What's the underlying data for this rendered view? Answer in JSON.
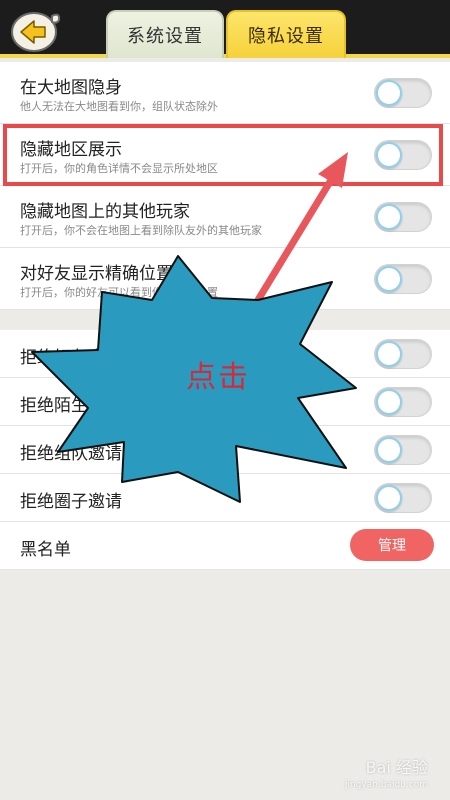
{
  "header": {
    "tabs": [
      {
        "label": "系统设置",
        "active": false
      },
      {
        "label": "隐私设置",
        "active": true
      }
    ]
  },
  "sections": [
    {
      "rows": [
        {
          "title": "在大地图隐身",
          "subtitle": "他人无法在大地图看到你，组队状态除外",
          "toggle_on": false
        },
        {
          "title": "隐藏地区展示",
          "subtitle": "打开后，你的角色详情不会显示所处地区",
          "toggle_on": false
        },
        {
          "title": "隐藏地图上的其他玩家",
          "subtitle": "打开后，你不会在地图上看到除队友外的其他玩家",
          "toggle_on": false
        },
        {
          "title": "对好友显示精确位置",
          "subtitle": "打开后，你的好友可以看到你的精确位置",
          "toggle_on": false
        }
      ]
    },
    {
      "rows": [
        {
          "title": "拒绝好友申请",
          "toggle_on": false
        },
        {
          "title": "拒绝陌生人消息",
          "toggle_on": false
        },
        {
          "title": "拒绝组队邀请",
          "toggle_on": false
        },
        {
          "title": "拒绝圈子邀请",
          "toggle_on": false
        },
        {
          "title": "黑名单",
          "button_label": "管理"
        }
      ]
    }
  ],
  "annotation": {
    "click_label": "点击",
    "highlight_color": "#e84a4a",
    "burst_color": "#2a9bbf"
  },
  "watermark": {
    "text": "Bai 经验",
    "subtext": "jingyan.baidu.com"
  },
  "colors": {
    "accent": "#f6d23a",
    "toggle_knob_ring": "#8fd0ee",
    "manage_button": "#f06464"
  }
}
